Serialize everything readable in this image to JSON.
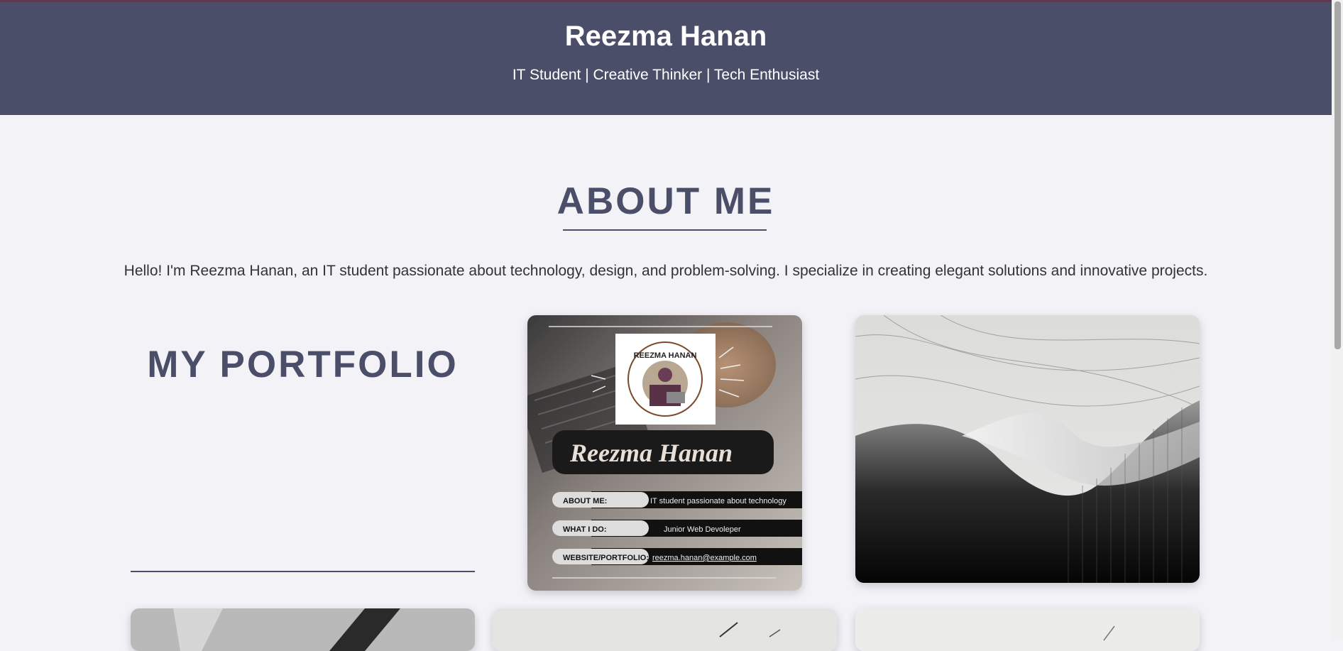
{
  "header": {
    "name": "Reezma Hanan",
    "tagline": "IT Student | Creative Thinker | Tech Enthusiast"
  },
  "about": {
    "title": "ABOUT ME",
    "text": "Hello! I'm Reezma Hanan, an IT student passionate about technology, design, and problem-solving. I specialize in creating elegant solutions and innovative projects."
  },
  "portfolio": {
    "title": "MY PORTFOLIO"
  },
  "profile_card": {
    "badge_text": "REEZMA HANAN",
    "name": "Reezma Hanan",
    "rows": [
      {
        "label": "ABOUT ME:",
        "value": "IT student passionate about technology"
      },
      {
        "label": "WHAT I DO:",
        "value": "Junior Web Devoleper"
      },
      {
        "label": "WEBSITE/PORTFOLIO:",
        "value": "reezma.hanan@example.com"
      }
    ]
  },
  "colors": {
    "header_bg": "#4a4e69",
    "page_bg": "#f3f2f7",
    "accent_text": "#4a4e69"
  }
}
